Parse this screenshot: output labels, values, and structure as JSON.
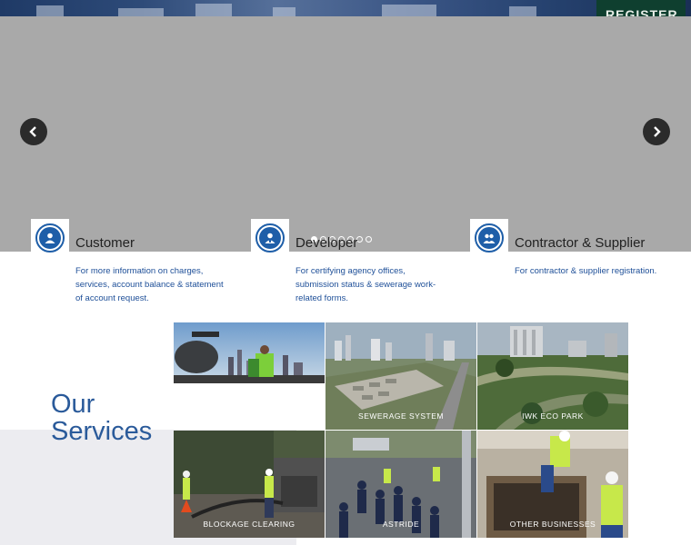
{
  "header": {
    "register_label": "REGISTER"
  },
  "slider": {
    "slide_count": 7,
    "active_index": 0
  },
  "cards": [
    {
      "title": "Customer",
      "description": "For more information on charges, services, account balance & statement of account request.",
      "icon": "customer-icon"
    },
    {
      "title": "Developer",
      "description": "For certifying agency offices, submission status & sewerage work-related forms.",
      "icon": "developer-icon"
    },
    {
      "title": "Contractor & Supplier",
      "description": "For contractor & supplier registration.",
      "icon": "contractor-supplier-icon"
    }
  ],
  "services": {
    "heading_line1": "Our",
    "heading_line2": "Services",
    "tiles": [
      {
        "caption": ""
      },
      {
        "caption": "SEWERAGE SYSTEM"
      },
      {
        "caption": "IWK ECO PARK"
      },
      {
        "caption": "BLOCKAGE CLEARING"
      },
      {
        "caption": "ASTRIDE"
      },
      {
        "caption": "OTHER BUSINESSES"
      }
    ]
  },
  "colors": {
    "accent_blue": "#1e5ea8",
    "heading_blue": "#2a5a9a",
    "slider_gray": "#a9a9a9"
  }
}
